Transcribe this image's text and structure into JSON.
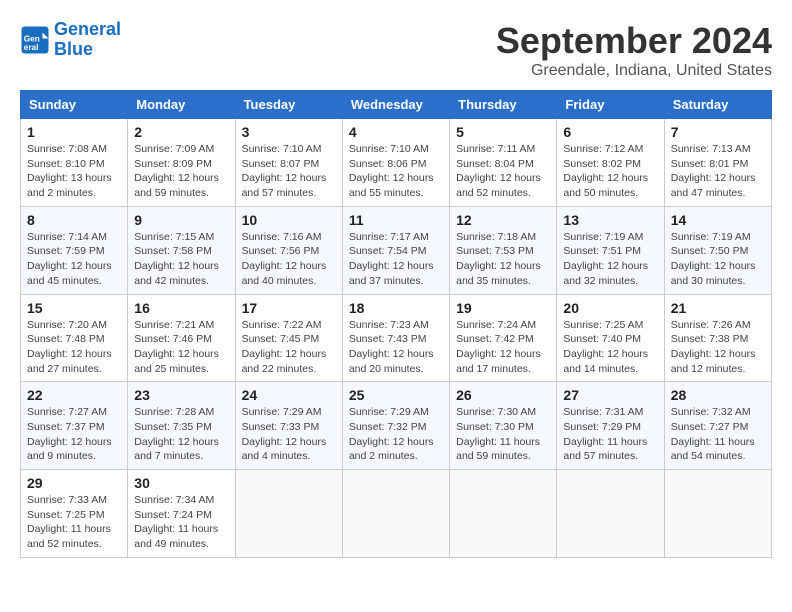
{
  "header": {
    "logo_line1": "General",
    "logo_line2": "Blue",
    "title": "September 2024",
    "subtitle": "Greendale, Indiana, United States"
  },
  "weekdays": [
    "Sunday",
    "Monday",
    "Tuesday",
    "Wednesday",
    "Thursday",
    "Friday",
    "Saturday"
  ],
  "weeks": [
    [
      {
        "day": "1",
        "sunrise": "Sunrise: 7:08 AM",
        "sunset": "Sunset: 8:10 PM",
        "daylight": "Daylight: 13 hours and 2 minutes."
      },
      {
        "day": "2",
        "sunrise": "Sunrise: 7:09 AM",
        "sunset": "Sunset: 8:09 PM",
        "daylight": "Daylight: 12 hours and 59 minutes."
      },
      {
        "day": "3",
        "sunrise": "Sunrise: 7:10 AM",
        "sunset": "Sunset: 8:07 PM",
        "daylight": "Daylight: 12 hours and 57 minutes."
      },
      {
        "day": "4",
        "sunrise": "Sunrise: 7:10 AM",
        "sunset": "Sunset: 8:06 PM",
        "daylight": "Daylight: 12 hours and 55 minutes."
      },
      {
        "day": "5",
        "sunrise": "Sunrise: 7:11 AM",
        "sunset": "Sunset: 8:04 PM",
        "daylight": "Daylight: 12 hours and 52 minutes."
      },
      {
        "day": "6",
        "sunrise": "Sunrise: 7:12 AM",
        "sunset": "Sunset: 8:02 PM",
        "daylight": "Daylight: 12 hours and 50 minutes."
      },
      {
        "day": "7",
        "sunrise": "Sunrise: 7:13 AM",
        "sunset": "Sunset: 8:01 PM",
        "daylight": "Daylight: 12 hours and 47 minutes."
      }
    ],
    [
      {
        "day": "8",
        "sunrise": "Sunrise: 7:14 AM",
        "sunset": "Sunset: 7:59 PM",
        "daylight": "Daylight: 12 hours and 45 minutes."
      },
      {
        "day": "9",
        "sunrise": "Sunrise: 7:15 AM",
        "sunset": "Sunset: 7:58 PM",
        "daylight": "Daylight: 12 hours and 42 minutes."
      },
      {
        "day": "10",
        "sunrise": "Sunrise: 7:16 AM",
        "sunset": "Sunset: 7:56 PM",
        "daylight": "Daylight: 12 hours and 40 minutes."
      },
      {
        "day": "11",
        "sunrise": "Sunrise: 7:17 AM",
        "sunset": "Sunset: 7:54 PM",
        "daylight": "Daylight: 12 hours and 37 minutes."
      },
      {
        "day": "12",
        "sunrise": "Sunrise: 7:18 AM",
        "sunset": "Sunset: 7:53 PM",
        "daylight": "Daylight: 12 hours and 35 minutes."
      },
      {
        "day": "13",
        "sunrise": "Sunrise: 7:19 AM",
        "sunset": "Sunset: 7:51 PM",
        "daylight": "Daylight: 12 hours and 32 minutes."
      },
      {
        "day": "14",
        "sunrise": "Sunrise: 7:19 AM",
        "sunset": "Sunset: 7:50 PM",
        "daylight": "Daylight: 12 hours and 30 minutes."
      }
    ],
    [
      {
        "day": "15",
        "sunrise": "Sunrise: 7:20 AM",
        "sunset": "Sunset: 7:48 PM",
        "daylight": "Daylight: 12 hours and 27 minutes."
      },
      {
        "day": "16",
        "sunrise": "Sunrise: 7:21 AM",
        "sunset": "Sunset: 7:46 PM",
        "daylight": "Daylight: 12 hours and 25 minutes."
      },
      {
        "day": "17",
        "sunrise": "Sunrise: 7:22 AM",
        "sunset": "Sunset: 7:45 PM",
        "daylight": "Daylight: 12 hours and 22 minutes."
      },
      {
        "day": "18",
        "sunrise": "Sunrise: 7:23 AM",
        "sunset": "Sunset: 7:43 PM",
        "daylight": "Daylight: 12 hours and 20 minutes."
      },
      {
        "day": "19",
        "sunrise": "Sunrise: 7:24 AM",
        "sunset": "Sunset: 7:42 PM",
        "daylight": "Daylight: 12 hours and 17 minutes."
      },
      {
        "day": "20",
        "sunrise": "Sunrise: 7:25 AM",
        "sunset": "Sunset: 7:40 PM",
        "daylight": "Daylight: 12 hours and 14 minutes."
      },
      {
        "day": "21",
        "sunrise": "Sunrise: 7:26 AM",
        "sunset": "Sunset: 7:38 PM",
        "daylight": "Daylight: 12 hours and 12 minutes."
      }
    ],
    [
      {
        "day": "22",
        "sunrise": "Sunrise: 7:27 AM",
        "sunset": "Sunset: 7:37 PM",
        "daylight": "Daylight: 12 hours and 9 minutes."
      },
      {
        "day": "23",
        "sunrise": "Sunrise: 7:28 AM",
        "sunset": "Sunset: 7:35 PM",
        "daylight": "Daylight: 12 hours and 7 minutes."
      },
      {
        "day": "24",
        "sunrise": "Sunrise: 7:29 AM",
        "sunset": "Sunset: 7:33 PM",
        "daylight": "Daylight: 12 hours and 4 minutes."
      },
      {
        "day": "25",
        "sunrise": "Sunrise: 7:29 AM",
        "sunset": "Sunset: 7:32 PM",
        "daylight": "Daylight: 12 hours and 2 minutes."
      },
      {
        "day": "26",
        "sunrise": "Sunrise: 7:30 AM",
        "sunset": "Sunset: 7:30 PM",
        "daylight": "Daylight: 11 hours and 59 minutes."
      },
      {
        "day": "27",
        "sunrise": "Sunrise: 7:31 AM",
        "sunset": "Sunset: 7:29 PM",
        "daylight": "Daylight: 11 hours and 57 minutes."
      },
      {
        "day": "28",
        "sunrise": "Sunrise: 7:32 AM",
        "sunset": "Sunset: 7:27 PM",
        "daylight": "Daylight: 11 hours and 54 minutes."
      }
    ],
    [
      {
        "day": "29",
        "sunrise": "Sunrise: 7:33 AM",
        "sunset": "Sunset: 7:25 PM",
        "daylight": "Daylight: 11 hours and 52 minutes."
      },
      {
        "day": "30",
        "sunrise": "Sunrise: 7:34 AM",
        "sunset": "Sunset: 7:24 PM",
        "daylight": "Daylight: 11 hours and 49 minutes."
      },
      null,
      null,
      null,
      null,
      null
    ]
  ]
}
